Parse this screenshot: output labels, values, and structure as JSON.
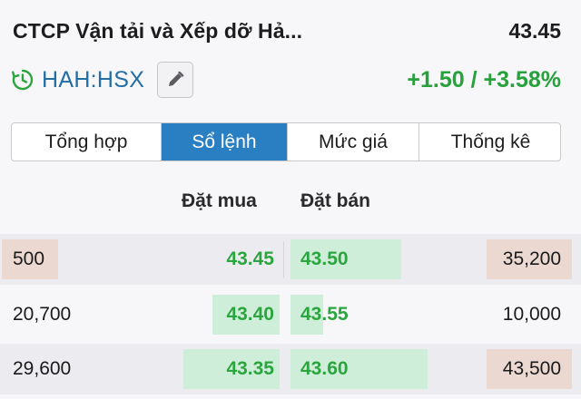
{
  "header": {
    "company_name": "CTCP Vận tải và Xếp dỡ Hả...",
    "price": "43.45"
  },
  "sub": {
    "ticker": "HAH:HSX",
    "change": "+1.50 / +3.58%",
    "clock_icon": "clock-icon",
    "edit_icon": "pencil-icon"
  },
  "tabs": [
    {
      "label": "Tổng hợp",
      "active": false
    },
    {
      "label": "Sổ lệnh",
      "active": true
    },
    {
      "label": "Mức giá",
      "active": false
    },
    {
      "label": "Thống kê",
      "active": false
    }
  ],
  "orderbook": {
    "bid_header": "Đặt mua",
    "ask_header": "Đặt bán",
    "rows": [
      {
        "bid_qty": "500",
        "bid_price": "43.45",
        "ask_price": "43.50",
        "ask_qty": "35,200",
        "bid_bar": 0.0,
        "ask_bar": 0.51
      },
      {
        "bid_qty": "20,700",
        "bid_price": "43.40",
        "ask_price": "43.55",
        "ask_qty": "10,000",
        "bid_bar": 0.31,
        "ask_bar": 0.15
      },
      {
        "bid_qty": "29,600",
        "bid_price": "43.35",
        "ask_price": "43.60",
        "ask_qty": "43,500",
        "bid_bar": 0.44,
        "ask_bar": 0.63
      }
    ]
  },
  "colors": {
    "accent": "#2a7ec2",
    "up": "#2ba53e",
    "ticker": "#236ea6",
    "bar_bg": "#cfeeda",
    "qty_highlight": "#ebd9d1"
  }
}
